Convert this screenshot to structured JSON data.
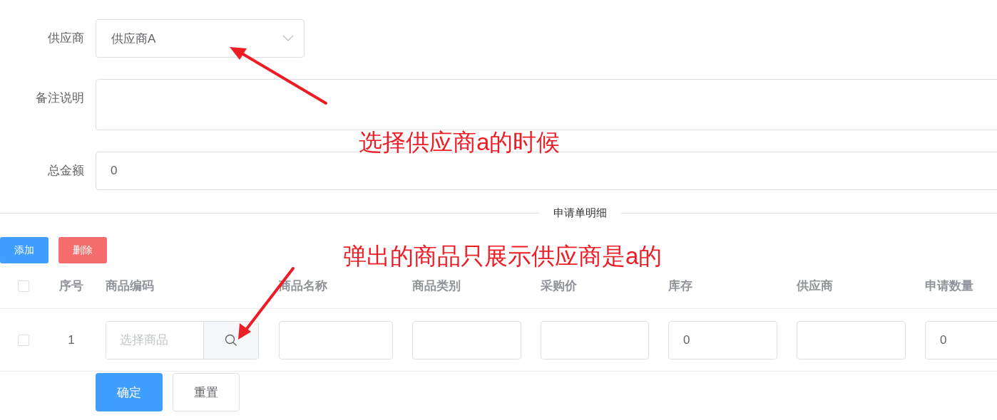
{
  "form": {
    "fields": [
      {
        "label": "供应商",
        "kind": "select",
        "value": "供应商A"
      },
      {
        "label": "备注说明",
        "kind": "textarea"
      },
      {
        "label": "总金额",
        "kind": "input",
        "value": "0"
      }
    ]
  },
  "divider": "申请单明细",
  "toolbar": [
    {
      "label": "添加",
      "kind": "primary"
    },
    {
      "label": "删除",
      "kind": "danger"
    }
  ],
  "table": {
    "header_checked": false,
    "columns": [
      "序号",
      "商品编码",
      "商品名称",
      "商品类别",
      "采购价",
      "库存",
      "供应商",
      "申请数量"
    ],
    "rows": [
      {
        "checked": false,
        "cells": [
          {
            "kind": "index",
            "value": "1"
          },
          {
            "kind": "picker",
            "placeholder": "选择商品"
          },
          {
            "kind": "input"
          },
          {
            "kind": "input"
          },
          {
            "kind": "input"
          },
          {
            "kind": "input",
            "value": "0"
          },
          {
            "kind": "input"
          },
          {
            "kind": "input",
            "value": "0"
          }
        ]
      }
    ]
  },
  "actions": [
    {
      "label": "确定",
      "kind": "primary"
    },
    {
      "label": "重置",
      "kind": "default"
    }
  ],
  "annotations": [
    {
      "text": "选择供应商a的时候"
    },
    {
      "text": "弹出的商品只展示供应商是a的"
    }
  ]
}
